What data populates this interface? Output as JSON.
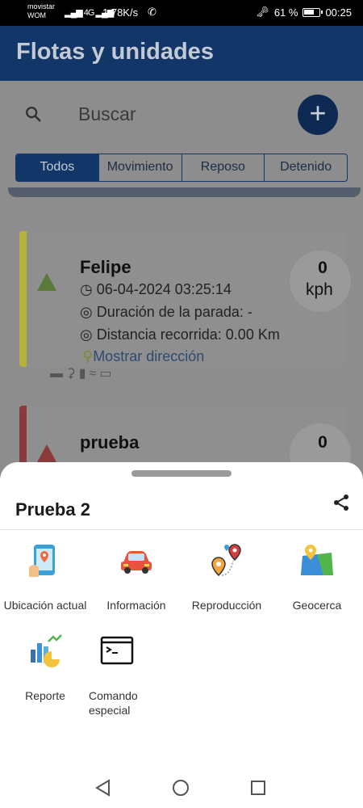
{
  "status": {
    "carrier_line1": "movistar",
    "carrier_line2": "WOM",
    "signal": "▂▄▆ 4G ▂▄▆",
    "net_speed": "1,78K/s",
    "battery": "61 %",
    "time": "00:25"
  },
  "app": {
    "title": "Flotas y unidades",
    "search_placeholder": "Buscar",
    "add_label": "+",
    "tabs": [
      "Todos",
      "Movimiento",
      "Reposo",
      "Detenido"
    ],
    "active_tab": 0
  },
  "cards": [
    {
      "name": "Felipe",
      "datetime": "06-04-2024 03:25:14",
      "stop_duration": "Duración de la parada: -",
      "distance": "Distancia recorrida: 0.00 Km",
      "address_link": "Mostrar dirección",
      "speed": "0",
      "speed_unit": "kph",
      "status_color": "#b5b23a",
      "arrow_color": "#5a7a37"
    },
    {
      "name": "prueba",
      "speed": "0",
      "status_color": "#8a3a3a",
      "arrow_color": "#8a3a3a"
    }
  ],
  "sheet": {
    "title": "Prueba 2",
    "actions": [
      {
        "label": "Ubicación actual",
        "icon": "phone-location-icon"
      },
      {
        "label": "Información",
        "icon": "car-icon"
      },
      {
        "label": "Reproducción",
        "icon": "route-pins-icon"
      },
      {
        "label": "Geocerca",
        "icon": "map-icon"
      },
      {
        "label": "Reporte",
        "icon": "chart-report-icon"
      },
      {
        "label": "Comando especial",
        "icon": "terminal-icon"
      }
    ]
  }
}
